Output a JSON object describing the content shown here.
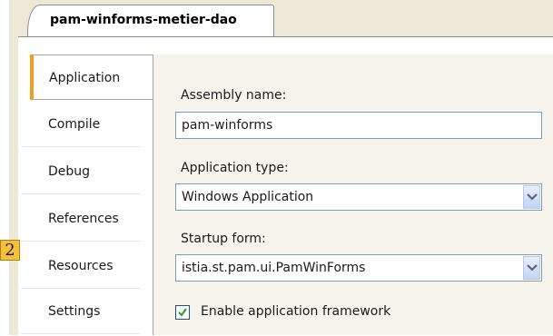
{
  "document_tab": {
    "title": "pam-winforms-metier-dao"
  },
  "nav": {
    "items": [
      {
        "label": "Application",
        "selected": true
      },
      {
        "label": "Compile"
      },
      {
        "label": "Debug"
      },
      {
        "label": "References"
      },
      {
        "label": "Resources"
      },
      {
        "label": "Settings"
      }
    ]
  },
  "form": {
    "assembly_name_label": "Assembly name:",
    "assembly_name_value": "pam-winforms",
    "application_type_label": "Application type:",
    "application_type_value": "Windows Application",
    "startup_form_label": "Startup form:",
    "startup_form_value": "istia.st.pam.ui.PamWinForms",
    "enable_framework_label": "Enable application framework",
    "enable_framework_checked": true
  },
  "annotation": {
    "badge": "2"
  },
  "icons": {
    "dropdown": "chevron-down-icon",
    "check": "check-icon"
  }
}
